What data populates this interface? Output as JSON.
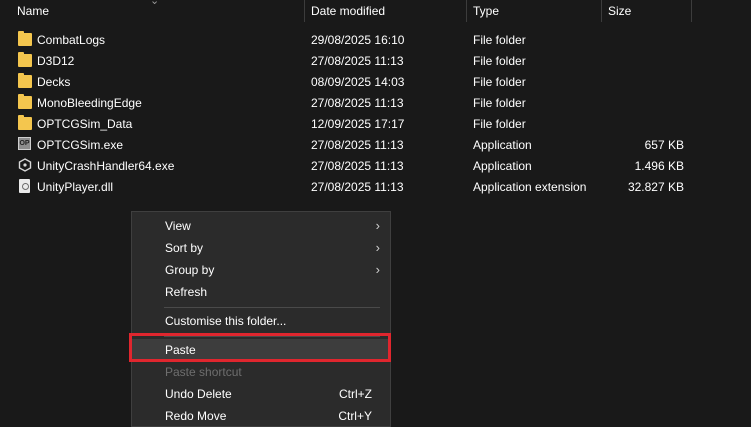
{
  "columns": {
    "name": "Name",
    "date_modified": "Date modified",
    "type": "Type",
    "size": "Size"
  },
  "files": [
    {
      "name": "CombatLogs",
      "date": "29/08/2025 16:10",
      "type": "File folder",
      "size": "",
      "icon": "folder-icon"
    },
    {
      "name": "D3D12",
      "date": "27/08/2025 11:13",
      "type": "File folder",
      "size": "",
      "icon": "folder-icon"
    },
    {
      "name": "Decks",
      "date": "08/09/2025 14:03",
      "type": "File folder",
      "size": "",
      "icon": "folder-icon"
    },
    {
      "name": "MonoBleedingEdge",
      "date": "27/08/2025 11:13",
      "type": "File folder",
      "size": "",
      "icon": "folder-icon"
    },
    {
      "name": "OPTCGSim_Data",
      "date": "12/09/2025 17:17",
      "type": "File folder",
      "size": "",
      "icon": "folder-icon"
    },
    {
      "name": "OPTCGSim.exe",
      "date": "27/08/2025 11:13",
      "type": "Application",
      "size": "657 KB",
      "icon": "app-icon"
    },
    {
      "name": "UnityCrashHandler64.exe",
      "date": "27/08/2025 11:13",
      "type": "Application",
      "size": "1.496 KB",
      "icon": "unity-icon"
    },
    {
      "name": "UnityPlayer.dll",
      "date": "27/08/2025 11:13",
      "type": "Application extension",
      "size": "32.827 KB",
      "icon": "dll-icon"
    }
  ],
  "context_menu": {
    "view": "View",
    "sort_by": "Sort by",
    "group_by": "Group by",
    "refresh": "Refresh",
    "customise": "Customise this folder...",
    "paste": "Paste",
    "paste_shortcut": "Paste shortcut",
    "undo_delete": "Undo Delete",
    "undo_delete_key": "Ctrl+Z",
    "redo_move": "Redo Move",
    "redo_move_key": "Ctrl+Y",
    "submenu_arrow": "›"
  },
  "colors": {
    "background": "#191919",
    "menu_background": "#2b2b2b",
    "highlight_border": "#e0262e",
    "folder": "#f4c64e"
  }
}
